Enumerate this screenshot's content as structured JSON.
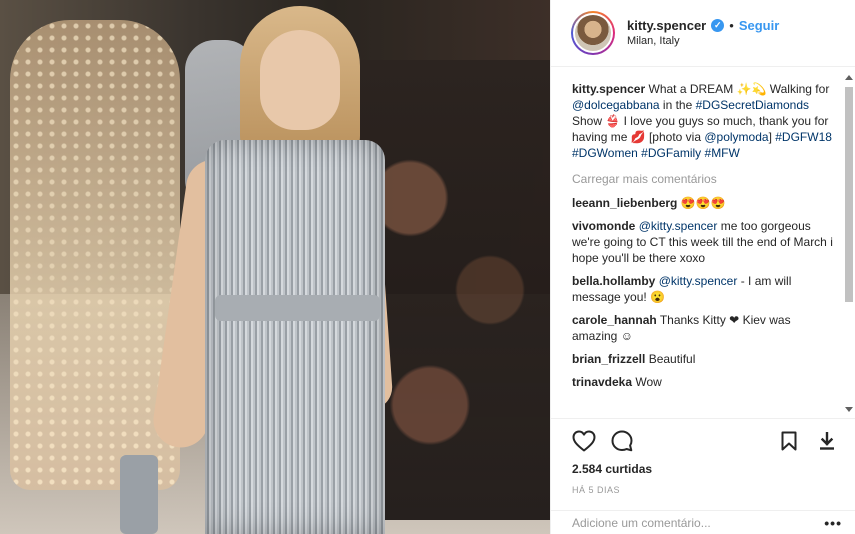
{
  "post": {
    "photo_alt": "Model walking runway in silver sequined dress"
  },
  "header": {
    "username": "kitty.spencer",
    "verified_glyph": "✓",
    "separator": "•",
    "follow_label": "Seguir",
    "location": "Milan, Italy"
  },
  "caption": {
    "username": "kitty.spencer",
    "parts": [
      {
        "text": " What a DREAM ✨💫 Walking for ",
        "link": false
      },
      {
        "text": "@dolcegabbana",
        "link": true
      },
      {
        "text": " in the ",
        "link": false
      },
      {
        "text": "#DGSecretDiamonds",
        "link": true
      },
      {
        "text": " Show 👙 I love you guys so much, thank you for having me 💋 [photo via ",
        "link": false
      },
      {
        "text": "@polymoda",
        "link": true
      },
      {
        "text": "] ",
        "link": false
      },
      {
        "text": "#DGFW18",
        "link": true
      },
      {
        "text": " ",
        "link": false
      },
      {
        "text": "#DGWomen",
        "link": true
      },
      {
        "text": " ",
        "link": false
      },
      {
        "text": "#DGFamily",
        "link": true
      },
      {
        "text": " ",
        "link": false
      },
      {
        "text": "#MFW",
        "link": true
      }
    ]
  },
  "load_more": "Carregar mais comentários",
  "comments": [
    {
      "user": "leeann_liebenberg",
      "parts": [
        {
          "text": " 😍😍😍",
          "link": false
        }
      ]
    },
    {
      "user": "vivomonde",
      "parts": [
        {
          "text": " ",
          "link": false
        },
        {
          "text": "@kitty.spencer",
          "link": true
        },
        {
          "text": " me too gorgeous we're going to CT this week till the end of March i hope you'll be there xoxo",
          "link": false
        }
      ]
    },
    {
      "user": "bella.hollamby",
      "parts": [
        {
          "text": " ",
          "link": false
        },
        {
          "text": "@kitty.spencer",
          "link": true
        },
        {
          "text": " - I am will message you! 😮",
          "link": false
        }
      ]
    },
    {
      "user": "carole_hannah",
      "parts": [
        {
          "text": " Thanks Kitty ❤ Kiev was amazing ☺",
          "link": false
        }
      ]
    },
    {
      "user": "brian_frizzell",
      "parts": [
        {
          "text": " Beautiful",
          "link": false
        }
      ]
    },
    {
      "user": "trinavdeka",
      "parts": [
        {
          "text": " Wow",
          "link": false
        }
      ]
    }
  ],
  "actions": {
    "like_icon": "heart-icon",
    "comment_icon": "comment-icon",
    "save_icon": "bookmark-icon",
    "download_icon": "download-icon"
  },
  "likes": "2.584 curtidas",
  "time_ago": "HÁ 5 DIAS",
  "add_comment_placeholder": "Adicione um comentário...",
  "more_options": "•••",
  "colors": {
    "link": "#003569",
    "accent": "#3897f0",
    "muted": "#999999"
  }
}
